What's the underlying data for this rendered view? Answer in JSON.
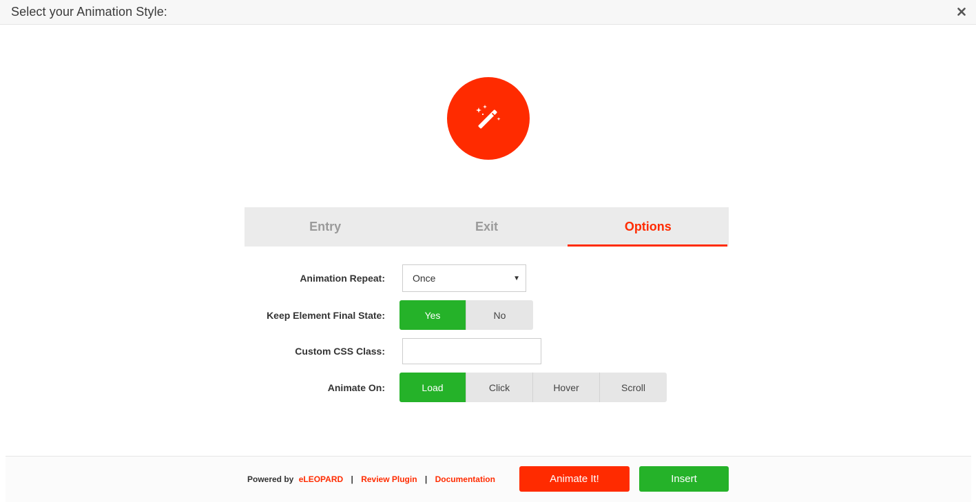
{
  "header": {
    "title": "Select your Animation Style:",
    "close_icon": "close-icon"
  },
  "hero": {
    "icon": "magic-wand-icon",
    "color": "#ff2b00"
  },
  "tabs": [
    {
      "label": "Entry",
      "active": false
    },
    {
      "label": "Exit",
      "active": false
    },
    {
      "label": "Options",
      "active": true
    }
  ],
  "form": {
    "animation_repeat": {
      "label": "Animation Repeat:",
      "value": "Once"
    },
    "keep_final_state": {
      "label": "Keep Element Final State:",
      "options": [
        "Yes",
        "No"
      ],
      "selected": "Yes"
    },
    "custom_css_class": {
      "label": "Custom CSS Class:",
      "value": ""
    },
    "animate_on": {
      "label": "Animate On:",
      "options": [
        "Load",
        "Click",
        "Hover",
        "Scroll"
      ],
      "selected": "Load"
    }
  },
  "footer": {
    "powered_by": "Powered by",
    "brand": "eLEOPARD",
    "separator": "|",
    "review": "Review Plugin",
    "docs": "Documentation",
    "animate_button": "Animate It!",
    "insert_button": "Insert"
  },
  "colors": {
    "accent": "#ff2b00",
    "success": "#25b229",
    "tab_bg": "#ebebeb"
  }
}
